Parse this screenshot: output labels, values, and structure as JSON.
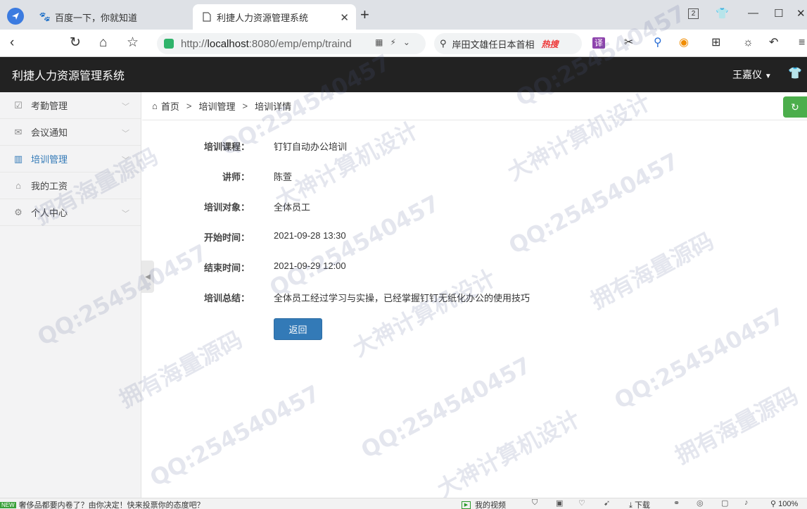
{
  "browser": {
    "tabs": [
      {
        "title": "百度一下，你就知道",
        "favicon": "baidu-paw-icon",
        "active": false
      },
      {
        "title": "利捷人力资源管理系统",
        "favicon": "page-icon",
        "active": true
      }
    ],
    "tab_count_badge": "2",
    "address": {
      "scheme": "http://",
      "host": "localhost",
      "rest": ":8080/emp/emp/traind"
    },
    "search": {
      "text": "岸田文雄任日本首相",
      "hot_label": "热搜"
    },
    "translate_label": "译"
  },
  "app": {
    "title": "利捷人力资源管理系统",
    "user_name": "王嘉仪"
  },
  "sidebar": {
    "items": [
      {
        "label": "考勤管理",
        "icon": "clipboard-check-icon",
        "has_chevron": true,
        "active": false
      },
      {
        "label": "会议通知",
        "icon": "envelope-icon",
        "has_chevron": true,
        "active": false
      },
      {
        "label": "培训管理",
        "icon": "columns-icon",
        "has_chevron": true,
        "active": true
      },
      {
        "label": "我的工资",
        "icon": "bank-icon",
        "has_chevron": false,
        "active": false
      },
      {
        "label": "个人中心",
        "icon": "gear-icon",
        "has_chevron": true,
        "active": false
      }
    ]
  },
  "breadcrumb": {
    "home": "首页",
    "sep": ">",
    "section": "培训管理",
    "current": "培训详情"
  },
  "detail": {
    "fields": [
      {
        "label": "培训课程：",
        "value": "钉钉自动办公培训"
      },
      {
        "label": "讲师：",
        "value": "陈萱"
      },
      {
        "label": "培训对象：",
        "value": "全体员工"
      },
      {
        "label": "开始时间：",
        "value": "2021-09-28 13:30"
      },
      {
        "label": "结束时间：",
        "value": "2021-09-29 12:00"
      },
      {
        "label": "培训总结：",
        "value": "全体员工经过学习与实操，已经掌握钉钉无纸化办公的使用技巧"
      }
    ],
    "back_label": "返回"
  },
  "watermarks": {
    "a": "QQ:254540457",
    "b": "拥有海量源码",
    "c": "大神计算机设计"
  },
  "statusbar": {
    "badge": "NEW",
    "news": "奢侈品都要内卷了？由你决定！快来投票你的态度吧？",
    "video": "我的视频",
    "download": "下载",
    "zoom": "100%"
  }
}
